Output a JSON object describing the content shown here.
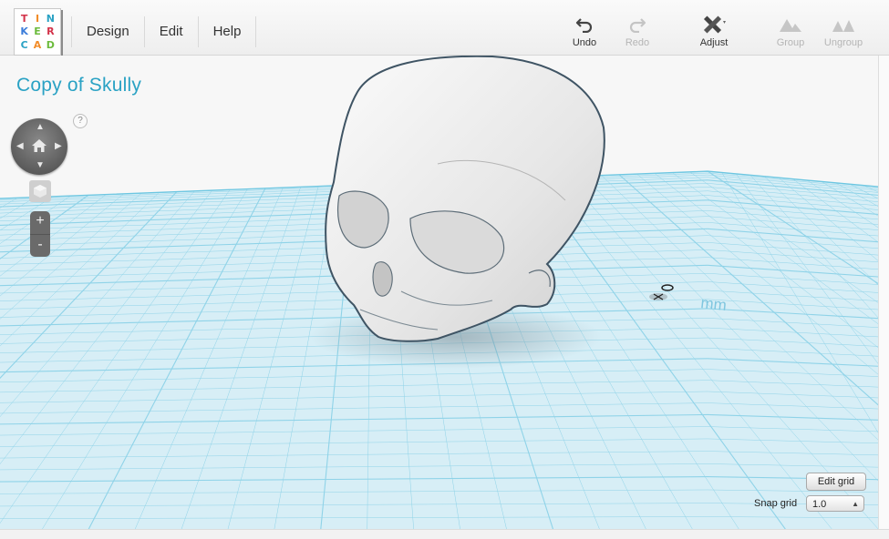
{
  "logo": {
    "letters": [
      "T",
      "I",
      "N",
      "K",
      "E",
      "R",
      "C",
      "A",
      "D"
    ]
  },
  "menu": {
    "items": [
      "Design",
      "Edit",
      "Help"
    ]
  },
  "toolbar": {
    "undo": "Undo",
    "redo": "Redo",
    "adjust": "Adjust",
    "group": "Group",
    "ungroup": "Ungroup"
  },
  "design": {
    "title": "Copy of Skully"
  },
  "navigation": {
    "help_label": "?",
    "zoom_in": "+",
    "zoom_out": "-"
  },
  "workplane": {
    "unit_label": "mm"
  },
  "grid": {
    "edit_label": "Edit grid",
    "snap_label": "Snap grid",
    "snap_value": "1.0"
  },
  "colors": {
    "accent": "#2aa2c4",
    "grid_line": "#7fcfe6",
    "grid_plane": "#d6eef6",
    "logo_t": "#d3334a",
    "logo_i": "#f28c28",
    "logo_n": "#2aa2c4",
    "logo_k": "#3c7dd9",
    "logo_e": "#6cbb3c",
    "logo_r": "#d3334a",
    "logo_c": "#2aa2c4",
    "logo_a": "#f28c28",
    "logo_d": "#6cbb3c"
  },
  "icons": {
    "undo": "undo-icon",
    "redo": "redo-icon",
    "adjust": "adjust-icon",
    "group": "group-icon",
    "ungroup": "ungroup-icon",
    "home": "home-icon",
    "cube": "view-cube-icon"
  }
}
